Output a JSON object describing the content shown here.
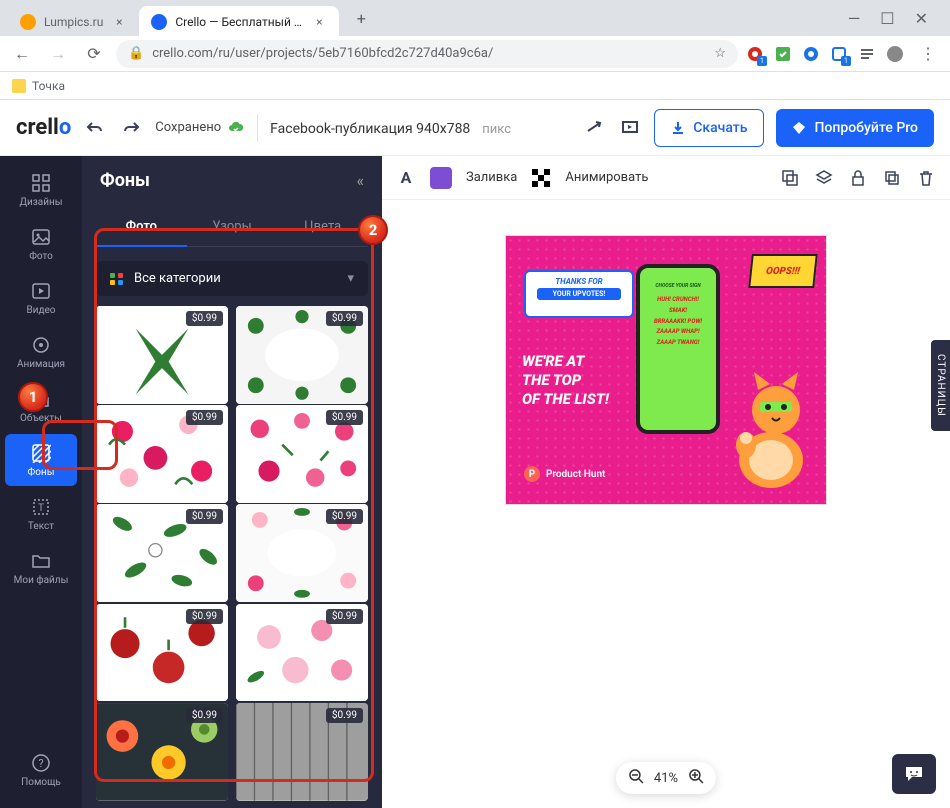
{
  "browser": {
    "tabs": [
      {
        "title": "Lumpics.ru",
        "favicon": "#ffa000"
      },
      {
        "title": "Crello — Бесплатный инструмен",
        "favicon": "#1b62f8",
        "active": true
      }
    ],
    "url": "crello.com/ru/user/projects/5eb7160bfcd2c727d40a9c6a/",
    "bookmarks": [
      {
        "label": "Точка"
      }
    ]
  },
  "header": {
    "logo": "crello",
    "saved_label": "Сохранено",
    "project_name": "Facebook-публикация 940x788",
    "dim_unit": "пикс",
    "download_label": "Скачать",
    "pro_label": "Попробуйте Pro"
  },
  "sidebar": {
    "items": [
      {
        "label": "Дизайны"
      },
      {
        "label": "Фото"
      },
      {
        "label": "Видео"
      },
      {
        "label": "Анимация"
      },
      {
        "label": "Объекты"
      },
      {
        "label": "Фоны",
        "active": true
      },
      {
        "label": "Текст"
      },
      {
        "label": "Мои файлы"
      }
    ],
    "help_label": "Помощь"
  },
  "panel": {
    "title": "Фоны",
    "tabs": [
      {
        "label": "Фото",
        "active": true
      },
      {
        "label": "Узоры"
      },
      {
        "label": "Цвета"
      }
    ],
    "category_label": "Все категории",
    "price": "$0.99"
  },
  "canvas": {
    "toolbar": {
      "fill_label": "Заливка",
      "animate_label": "Анимировать"
    },
    "artboard": {
      "thanks_top": "THANKS FOR",
      "thanks_bottom": "YOUR UPVOTES!",
      "oops": "OOPS!!!",
      "main_text": "WE'RE AT\nTHE TOP\nOF THE LIST!",
      "phone_title": "CHOOSE YOUR SIGN",
      "phone_lines": "HUH!  CRUNCH!!\nSMAK!\nBRRAAAKK! POW!\nZAAAAP  WHAP!\nZAAAP  TWANG!",
      "ph_badge": "P",
      "ph_label": "Product Hunt"
    },
    "zoom": "41%",
    "pages_tab": "СТРАНИЦЫ"
  },
  "markers": {
    "one": "1",
    "two": "2"
  }
}
